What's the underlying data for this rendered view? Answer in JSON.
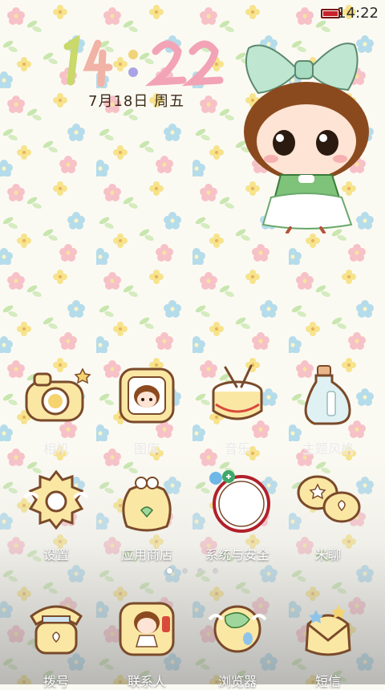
{
  "status_bar": {
    "time": "14:22",
    "battery_icon": "battery-icon"
  },
  "clock_widget": {
    "time_digits": [
      "1",
      "4",
      ":",
      "2",
      "2"
    ],
    "date": "7月18日 周五"
  },
  "page_indicator": {
    "pages": 4,
    "active_index": 0
  },
  "apps_row1": [
    {
      "label": "相机",
      "icon": "camera-icon"
    },
    {
      "label": "图库",
      "icon": "photo-frame-icon"
    },
    {
      "label": "音乐",
      "icon": "drum-icon"
    },
    {
      "label": "主题风格",
      "icon": "bottle-icon"
    }
  ],
  "apps_row2": [
    {
      "label": "设置",
      "icon": "gear-icon"
    },
    {
      "label": "应用商店",
      "icon": "gift-bag-icon"
    },
    {
      "label": "系统与安全",
      "icon": "security-ring-icon"
    },
    {
      "label": "米聊",
      "icon": "chat-bubbles-icon"
    }
  ],
  "dock": [
    {
      "label": "拨号",
      "icon": "telephone-icon"
    },
    {
      "label": "联系人",
      "icon": "contact-card-icon"
    },
    {
      "label": "浏览器",
      "icon": "globe-icon"
    },
    {
      "label": "短信",
      "icon": "envelope-icon"
    }
  ],
  "colors": {
    "accent_red": "#c8232a",
    "outline_brown": "#7a4a2a",
    "icon_cream": "#fbe7a4"
  }
}
